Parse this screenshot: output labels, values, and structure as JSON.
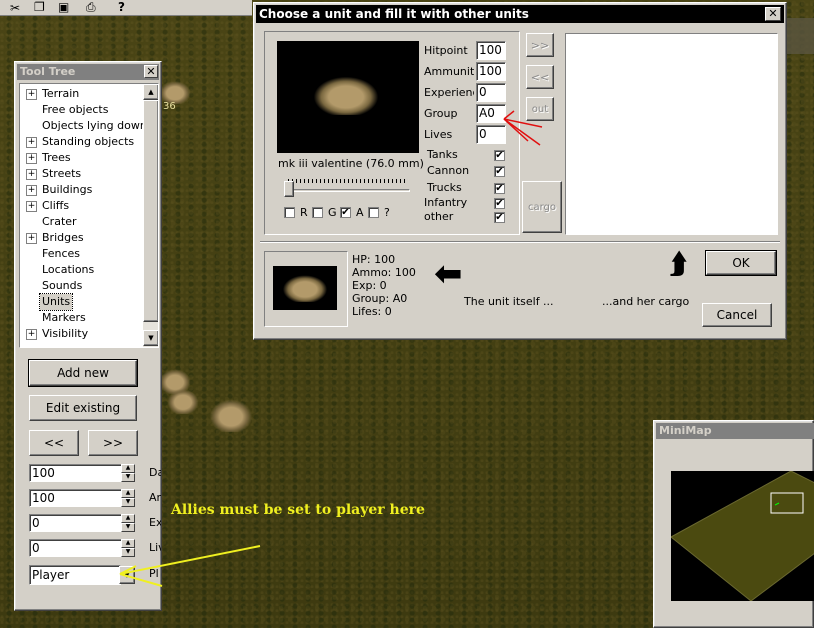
{
  "toolbar": {
    "icons": [
      "scissors-icon",
      "copy-icon",
      "paste-icon",
      "print-icon",
      "help-icon"
    ]
  },
  "map_labels": {
    "unit_number": "36"
  },
  "tool_tree": {
    "title": "Tool Tree",
    "items": [
      {
        "label": "Terrain",
        "expandable": true
      },
      {
        "label": "Free objects",
        "expandable": false
      },
      {
        "label": "Objects lying down",
        "expandable": false
      },
      {
        "label": "Standing objects",
        "expandable": true
      },
      {
        "label": "Trees",
        "expandable": true
      },
      {
        "label": "Streets",
        "expandable": true
      },
      {
        "label": "Buildings",
        "expandable": true
      },
      {
        "label": "Cliffs",
        "expandable": true
      },
      {
        "label": "Crater",
        "expandable": false
      },
      {
        "label": "Bridges",
        "expandable": true
      },
      {
        "label": "Fences",
        "expandable": false
      },
      {
        "label": "Locations",
        "expandable": false
      },
      {
        "label": "Sounds",
        "expandable": false
      },
      {
        "label": "Units",
        "expandable": false,
        "selected": true
      },
      {
        "label": "Markers",
        "expandable": false
      },
      {
        "label": "Visibility",
        "expandable": true
      }
    ],
    "add_new": "Add new",
    "edit_existing": "Edit existing",
    "prev": "<<",
    "next": ">>",
    "fields": [
      {
        "value": "100",
        "label": "Da"
      },
      {
        "value": "100",
        "label": "Ar"
      },
      {
        "value": "0",
        "label": "Ex"
      },
      {
        "value": "0",
        "label": "Liv"
      }
    ],
    "combo_value": "Player",
    "combo_label": "Pl"
  },
  "annotation": {
    "text": "Allies must be set to player  here",
    "color": "#f0f020"
  },
  "dialog": {
    "title": "Choose a unit and fill it with other units",
    "unit_name": "mk iii valentine (76.0 mm)",
    "stats": [
      {
        "label": "Hitpoint",
        "value": "100"
      },
      {
        "label": "Ammunitio",
        "value": "100"
      },
      {
        "label": "Experienc",
        "value": "0"
      },
      {
        "label": "Group",
        "value": "A0"
      },
      {
        "label": "Lives",
        "value": "0"
      }
    ],
    "checks": [
      {
        "label": "Tanks",
        "checked": true
      },
      {
        "label": "Cannon",
        "checked": true
      },
      {
        "label": "Trucks",
        "checked": true
      },
      {
        "label": "Infantry",
        "checked": true
      },
      {
        "label": "other",
        "checked": true
      }
    ],
    "filters": [
      {
        "label": "R",
        "checked": false
      },
      {
        "label": "G",
        "checked": false
      },
      {
        "label": "A",
        "checked": true
      },
      {
        "label": "?",
        "checked": false
      }
    ],
    "btn_add": ">>",
    "btn_remove": "<<",
    "btn_out": "out",
    "btn_cargo": "cargo",
    "summary": [
      "HP: 100",
      "Ammo: 100",
      "Exp: 0",
      "Group: A0",
      "Lifes: 0"
    ],
    "unit_itself": "The unit itself ...",
    "her_cargo": "...and her cargo",
    "ok": "OK",
    "cancel": "Cancel"
  },
  "minimap": {
    "title": "MiniMap",
    "terrain_color": "#4b4a10"
  }
}
